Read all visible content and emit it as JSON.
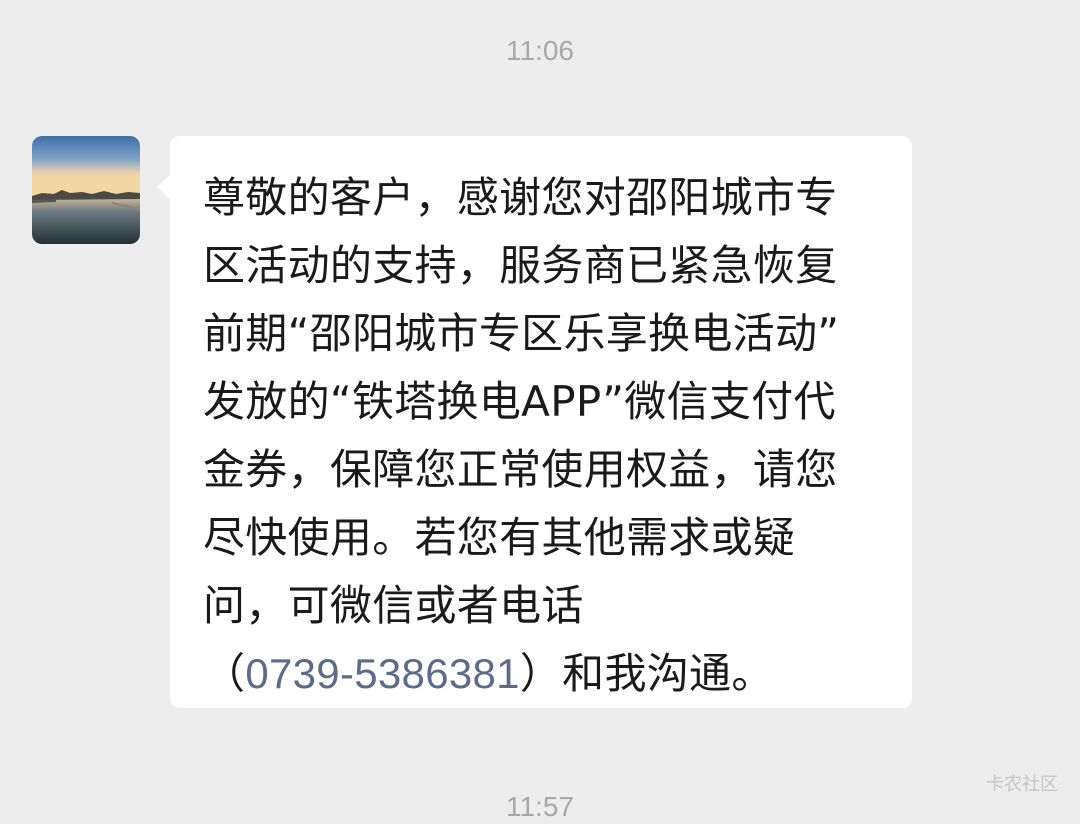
{
  "chat": {
    "timestamp_top": "11:06",
    "timestamp_bottom": "11:57",
    "message": {
      "lines": [
        "尊敬的客户，感谢您对邵阳城市专",
        "区活动的支持，服务商已紧急恢复",
        "前期“邵阳城市专区乐享换电活动”",
        "发放的“铁塔换电APP”微信支付代",
        "金券，保障您正常使用权益，请您",
        "尽快使用。若您有其他需求或疑",
        "问，可微信或者电话"
      ],
      "last_line_prefix": "（",
      "phone": "0739-5386381",
      "last_line_suffix": "）和我沟通。"
    }
  },
  "watermark": "卡农社区",
  "colors": {
    "background": "#ededed",
    "bubble": "#ffffff",
    "text": "#1a1a1a",
    "timestamp": "#a8a8a8",
    "phone_link": "#5b6b8c"
  },
  "icons": {
    "avatar": "lake-sunset-avatar"
  }
}
